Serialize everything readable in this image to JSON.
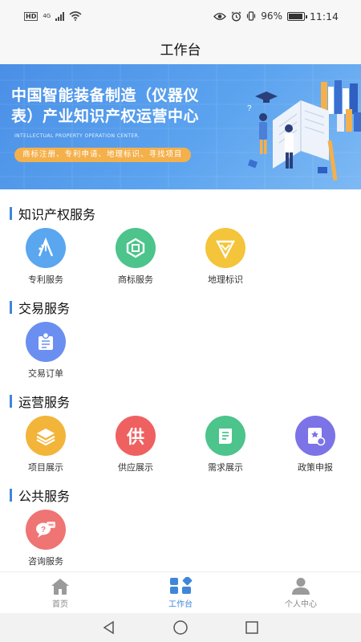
{
  "status_bar": {
    "network_badge": "HD",
    "signal_label": "4G",
    "battery": "96%",
    "battery_level": 0.96,
    "time": "11:14"
  },
  "header": {
    "title": "工作台"
  },
  "banner": {
    "title_line1": "中国智能装备制造（仪器仪",
    "title_line2": "表）产业知识产权运营中心",
    "subtitle_en": "INTELLECTUAL PROPERTY OPERATION CENTER.",
    "tagline": "商标注册、专利申请、地理标识、寻找项目"
  },
  "sections": [
    {
      "title": "知识产权服务",
      "items": [
        {
          "label": "专利服务",
          "icon": "patent-icon",
          "color": "#5aa6ef"
        },
        {
          "label": "商标服务",
          "icon": "trademark-icon",
          "color": "#4cc48b"
        },
        {
          "label": "地理标识",
          "icon": "geo-mark-icon",
          "color": "#f4c43a"
        }
      ]
    },
    {
      "title": "交易服务",
      "items": [
        {
          "label": "交易订单",
          "icon": "trade-order-icon",
          "color": "#6b8ff0"
        }
      ]
    },
    {
      "title": "运营服务",
      "items": [
        {
          "label": "项目展示",
          "icon": "project-icon",
          "color": "#f2b53a"
        },
        {
          "label": "供应展示",
          "icon": "supply-icon",
          "color": "#ef6161",
          "glyph": "供"
        },
        {
          "label": "需求展示",
          "icon": "demand-icon",
          "color": "#4cc48b"
        },
        {
          "label": "政策申报",
          "icon": "policy-icon",
          "color": "#7b73e6"
        }
      ]
    },
    {
      "title": "公共服务",
      "items": [
        {
          "label": "咨询服务",
          "icon": "consult-icon",
          "color": "#ef7474"
        }
      ]
    }
  ],
  "bottom_nav": [
    {
      "label": "首页",
      "icon": "home-icon",
      "active": false
    },
    {
      "label": "工作台",
      "icon": "workbench-icon",
      "active": true
    },
    {
      "label": "个人中心",
      "icon": "profile-icon",
      "active": false
    }
  ],
  "colors": {
    "accent": "#3f86d9",
    "banner_blue": "#4a8fe6",
    "tag_orange": "#f4b04b"
  }
}
